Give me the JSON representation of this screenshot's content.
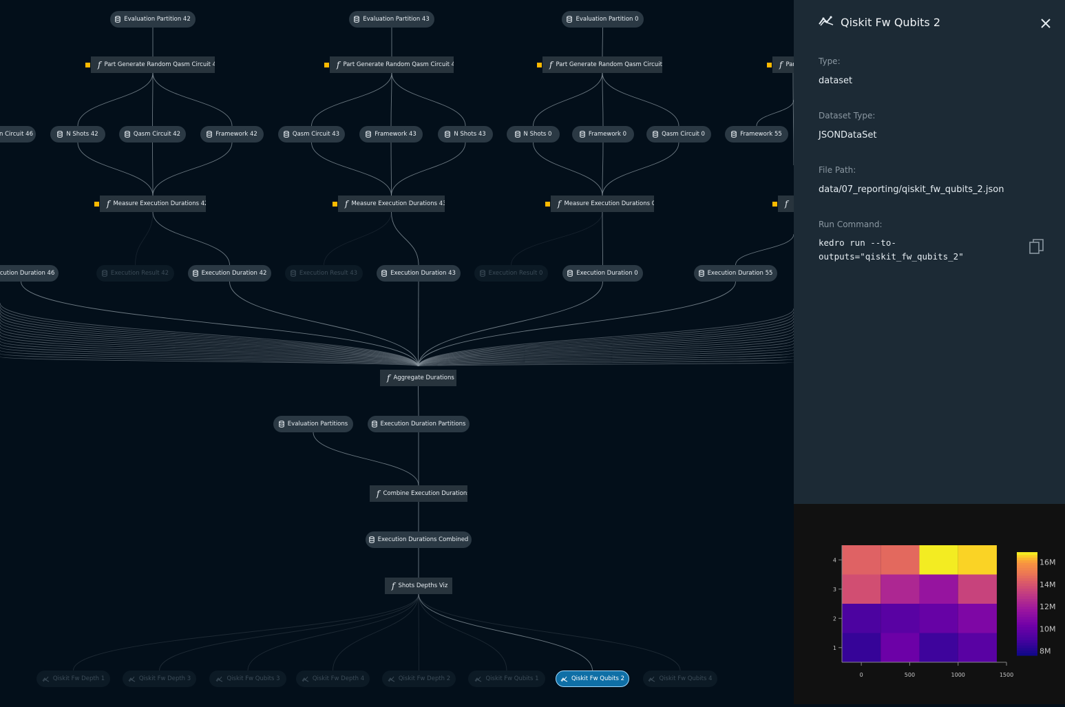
{
  "graph": {
    "nodes": [
      {
        "id": "ep42",
        "kind": "data",
        "label": "Evaluation Partition 42"
      },
      {
        "id": "ep43",
        "kind": "data",
        "label": "Evaluation Partition 43"
      },
      {
        "id": "ep0",
        "kind": "data",
        "label": "Evaluation Partition 0"
      },
      {
        "id": "pg42",
        "kind": "task",
        "label": "Part Generate Random Qasm Circuit 42",
        "param": true
      },
      {
        "id": "pg43",
        "kind": "task",
        "label": "Part Generate Random Qasm Circuit 43",
        "param": true
      },
      {
        "id": "pg0",
        "kind": "task",
        "label": "Part Generate Random Qasm Circuit 0",
        "param": true
      },
      {
        "id": "pg55",
        "kind": "task",
        "label": "Par",
        "param": true
      },
      {
        "id": "qc46",
        "kind": "data",
        "label": "n Circuit 46"
      },
      {
        "id": "ns42",
        "kind": "data",
        "label": "N Shots 42"
      },
      {
        "id": "qc42",
        "kind": "data",
        "label": "Qasm Circuit 42"
      },
      {
        "id": "fw42",
        "kind": "data",
        "label": "Framework 42"
      },
      {
        "id": "qc43",
        "kind": "data",
        "label": "Qasm Circuit 43"
      },
      {
        "id": "fw43",
        "kind": "data",
        "label": "Framework 43"
      },
      {
        "id": "ns43",
        "kind": "data",
        "label": "N Shots 43"
      },
      {
        "id": "ns0",
        "kind": "data",
        "label": "N Shots 0"
      },
      {
        "id": "fw0",
        "kind": "data",
        "label": "Framework 0"
      },
      {
        "id": "qc0",
        "kind": "data",
        "label": "Qasm Circuit 0"
      },
      {
        "id": "fw55",
        "kind": "data",
        "label": "Framework 55"
      },
      {
        "id": "me42",
        "kind": "task",
        "label": "Measure Execution Durations 42",
        "param": true
      },
      {
        "id": "me43",
        "kind": "task",
        "label": "Measure Execution Durations 43",
        "param": true
      },
      {
        "id": "me0",
        "kind": "task",
        "label": "Measure Execution Durations 0",
        "param": true
      },
      {
        "id": "me55",
        "kind": "task",
        "label": "",
        "param": true
      },
      {
        "id": "ed46",
        "kind": "data",
        "label": "ecution Duration 46"
      },
      {
        "id": "er42",
        "kind": "data",
        "label": "Execution Result 42",
        "faded": true
      },
      {
        "id": "ed42",
        "kind": "data",
        "label": "Execution Duration 42"
      },
      {
        "id": "er43",
        "kind": "data",
        "label": "Execution Result 43",
        "faded": true
      },
      {
        "id": "ed43",
        "kind": "data",
        "label": "Execution Duration 43"
      },
      {
        "id": "er0",
        "kind": "data",
        "label": "Execution Result 0",
        "faded": true
      },
      {
        "id": "ed0",
        "kind": "data",
        "label": "Execution Duration 0"
      },
      {
        "id": "ed55",
        "kind": "data",
        "label": "Execution Duration 55"
      },
      {
        "id": "agg",
        "kind": "task",
        "label": "Aggregate Durations"
      },
      {
        "id": "eps",
        "kind": "data",
        "label": "Evaluation Partitions"
      },
      {
        "id": "edp",
        "kind": "data",
        "label": "Execution Duration Partitions"
      },
      {
        "id": "ced",
        "kind": "task",
        "label": "Combine Execution Durations"
      },
      {
        "id": "edc",
        "kind": "data",
        "label": "Execution Durations Combined"
      },
      {
        "id": "sdv",
        "kind": "task",
        "label": "Shots Depths Viz"
      },
      {
        "id": "fd1",
        "kind": "plot",
        "label": "Qiskit Fw Depth 1",
        "faded": true
      },
      {
        "id": "fd3",
        "kind": "plot",
        "label": "Qiskit Fw Depth 3",
        "faded": true
      },
      {
        "id": "fq3",
        "kind": "plot",
        "label": "Qiskit Fw Qubits 3",
        "faded": true
      },
      {
        "id": "fd4",
        "kind": "plot",
        "label": "Qiskit Fw Depth 4",
        "faded": true
      },
      {
        "id": "fd2",
        "kind": "plot",
        "label": "Qiskit Fw Depth 2",
        "faded": true
      },
      {
        "id": "fq1",
        "kind": "plot",
        "label": "Qiskit Fw Qubits 1",
        "faded": true
      },
      {
        "id": "fq2",
        "kind": "plot",
        "label": "Qiskit Fw Qubits 2",
        "selected": true
      },
      {
        "id": "fq4",
        "kind": "plot",
        "label": "Qiskit Fw Qubits 4",
        "faded": true
      }
    ]
  },
  "panel": {
    "title": "Qiskit Fw Qubits 2",
    "title_icon": "plot-icon",
    "type_label": "Type:",
    "type_value": "dataset",
    "dataset_type_label": "Dataset Type:",
    "dataset_type_value": "JSONDataSet",
    "file_path_label": "File Path:",
    "file_path_value": "data/07_reporting/qiskit_fw_qubits_2.json",
    "run_command_label": "Run Command:",
    "run_command_value": "kedro run --to-outputs=\"qiskit_fw_qubits_2\""
  },
  "chart_data": {
    "type": "heatmap",
    "x": [
      0,
      400,
      800,
      1200
    ],
    "y": [
      1,
      2,
      3,
      4
    ],
    "z": [
      [
        8.6,
        10.2,
        8.8,
        9.6
      ],
      [
        9.2,
        9.6,
        10.0,
        10.8
      ],
      [
        13.8,
        12.4,
        11.6,
        13.4
      ],
      [
        14.4,
        14.6,
        16.8,
        16.6
      ]
    ],
    "z_unit": "M",
    "xticks": [
      "0",
      "500",
      "1000",
      "1500"
    ],
    "xtick_values": [
      0,
      500,
      1000,
      1500
    ],
    "yticks": [
      "1",
      "2",
      "3",
      "4"
    ],
    "colorbar_ticks": [
      "8M",
      "10M",
      "12M",
      "14M",
      "16M"
    ],
    "colorbar_values": [
      8,
      10,
      12,
      14,
      16
    ],
    "zlim": [
      7.6,
      16.9
    ],
    "colorscale": "plasma"
  }
}
